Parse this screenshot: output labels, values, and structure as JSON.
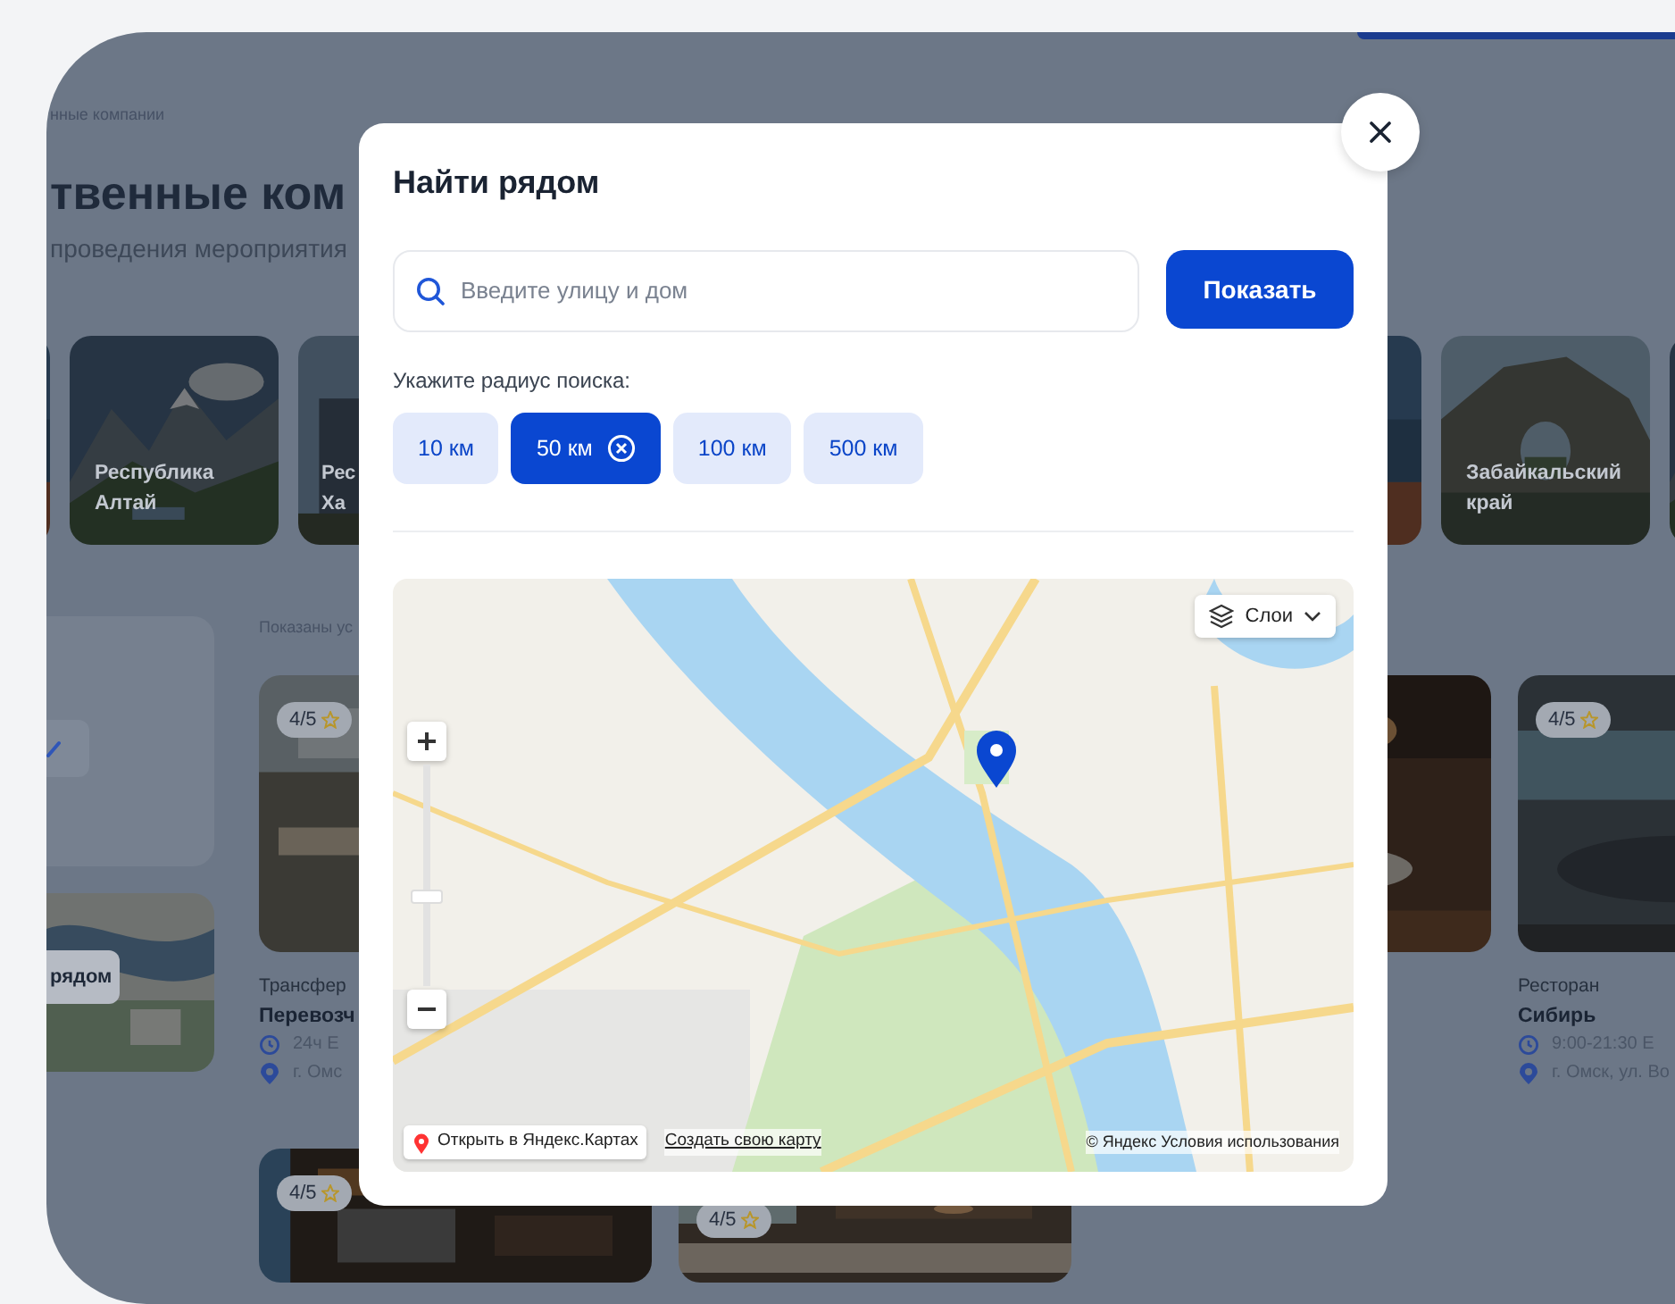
{
  "backdrop": {
    "breadcrumb": "нные компании",
    "heading": "твенные ком",
    "subtitle": "проведения мероприятия",
    "regions": [
      {
        "kind": "picture"
      },
      {
        "kind": "picture",
        "label": "Республика Алтай"
      },
      {
        "kind": "picture",
        "label": "Рес Ха"
      },
      {
        "kind": "picture"
      },
      {
        "kind": "picture",
        "label": "Забайкальский край"
      },
      {
        "kind": "picture"
      }
    ],
    "sidebar": {
      "map_button": "рядом"
    },
    "listing": {
      "note": "Показаны ус",
      "top_row": [
        {
          "rating": "4/5",
          "category": "Трансфер",
          "name": "Перевозч",
          "hours": "24ч Е",
          "address": "г. Омс"
        },
        {
          "kind": "picture"
        },
        {
          "rating": "4/5",
          "category": "Ресторан",
          "name": "Сибирь",
          "hours": "9:00-21:30 Е",
          "address": "г. Омск, ул. Во"
        }
      ],
      "bottom_row": [
        {
          "rating": "4/5"
        },
        {
          "rating": "4/5"
        }
      ]
    }
  },
  "modal": {
    "title": "Найти рядом",
    "search": {
      "placeholder": "Введите улицу и дом"
    },
    "submit": "Показать",
    "radius_label": "Укажите радиус поиска:",
    "radii": [
      {
        "label": "10 км",
        "selected": false
      },
      {
        "label": "50 км",
        "selected": true
      },
      {
        "label": "100 км",
        "selected": false
      },
      {
        "label": "500 км",
        "selected": false
      }
    ],
    "map": {
      "kind": "picture",
      "layers_button": "Слои",
      "zoom_slider": {
        "level": 0.4
      },
      "open_link": "Открыть в Яндекс.Картах",
      "create_link": "Создать свою карту",
      "copyright": "© Яндекс",
      "terms_link": "Условия использования"
    }
  }
}
